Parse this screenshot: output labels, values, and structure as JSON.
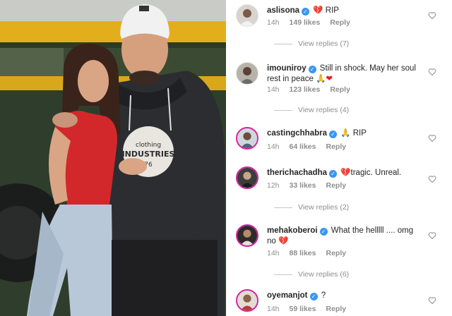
{
  "comments": [
    {
      "username": "aslisona",
      "text": "RIP",
      "prefix_emoji": "💔",
      "time": "14h",
      "likes": "149 likes",
      "reply": "Reply",
      "view_replies": "View replies (7)"
    },
    {
      "username": "imouniroy",
      "text": "Still in shock. May her soul rest in peace",
      "suffix_emoji": "🙏❤",
      "time": "14h",
      "likes": "123 likes",
      "reply": "Reply",
      "view_replies": "View replies (4)"
    },
    {
      "username": "castingchhabra",
      "prefix_emoji": "🙏",
      "text": "RIP",
      "time": "14h",
      "likes": "64 likes",
      "reply": "Reply"
    },
    {
      "username": "therichachadha",
      "prefix_emoji": "💔",
      "text": "tragic. Unreal.",
      "time": "12h",
      "likes": "33 likes",
      "reply": "Reply",
      "view_replies": "View replies (2)"
    },
    {
      "username": "mehakoberoi",
      "text": "What the helllll .... omg no",
      "suffix_emoji": "💔",
      "time": "14h",
      "likes": "88 likes",
      "reply": "Reply",
      "view_replies": "View replies (6)"
    },
    {
      "username": "oyemanjot",
      "text": "",
      "suffix_emoji": "?",
      "time": "14h",
      "likes": "59 likes",
      "reply": "Reply"
    }
  ],
  "colors": {
    "verified": "#3897f0",
    "meta_gray": "#8e8e8e",
    "text": "#262626",
    "shirt_red": "#d42a2c",
    "hoodie": "#2d2f33",
    "bus_yellow": "#e7b21a",
    "bus_green": "#3f4f36"
  },
  "icons": {
    "verified": "verified-badge-icon",
    "like": "heart-outline-icon"
  }
}
